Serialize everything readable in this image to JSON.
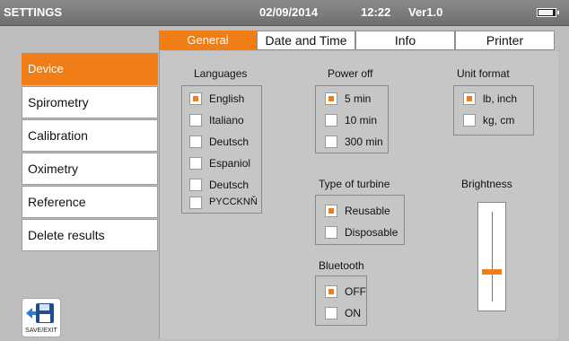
{
  "statusbar": {
    "title": "SETTINGS",
    "date": "02/09/2014",
    "time": "12:22",
    "version": "Ver1.0",
    "battery_icon": "battery-icon"
  },
  "tabs": [
    {
      "label": "General",
      "active": true
    },
    {
      "label": "Date and Time",
      "active": false
    },
    {
      "label": "Info",
      "active": false
    },
    {
      "label": "Printer",
      "active": false
    }
  ],
  "menu": [
    {
      "label": "Device",
      "active": true
    },
    {
      "label": "Spirometry",
      "active": false
    },
    {
      "label": "Calibration",
      "active": false
    },
    {
      "label": "Oximetry",
      "active": false
    },
    {
      "label": "Reference",
      "active": false
    },
    {
      "label": "Delete results",
      "active": false
    }
  ],
  "languages": {
    "title": "Languages",
    "options": [
      {
        "label": "English",
        "checked": true
      },
      {
        "label": "Italiano",
        "checked": false
      },
      {
        "label": "Deutsch",
        "checked": false
      },
      {
        "label": "Espaniol",
        "checked": false
      },
      {
        "label": "Deutsch",
        "checked": false
      },
      {
        "label": "РYCCKNŇ",
        "checked": false
      }
    ]
  },
  "power_off": {
    "title": "Power off",
    "options": [
      {
        "label": "5 min",
        "checked": true
      },
      {
        "label": "10 min",
        "checked": false
      },
      {
        "label": "300 min",
        "checked": false
      }
    ]
  },
  "unit_format": {
    "title": "Unit format",
    "options": [
      {
        "label": "lb, inch",
        "checked": true
      },
      {
        "label": "kg, cm",
        "checked": false
      }
    ]
  },
  "turbine": {
    "title": "Type of turbine",
    "options": [
      {
        "label": "Reusable",
        "checked": true
      },
      {
        "label": "Disposable",
        "checked": false
      }
    ]
  },
  "bluetooth": {
    "title": "Bluetooth",
    "options": [
      {
        "label": "OFF",
        "checked": true
      },
      {
        "label": "ON",
        "checked": false
      }
    ]
  },
  "brightness": {
    "title": "Brightness",
    "level": 0.33
  },
  "save_exit": {
    "label": "SAVE/EXIT",
    "icon": "floppy-disk-icon"
  },
  "colors": {
    "accent": "#f07d16",
    "background": "#c6c6c6"
  }
}
